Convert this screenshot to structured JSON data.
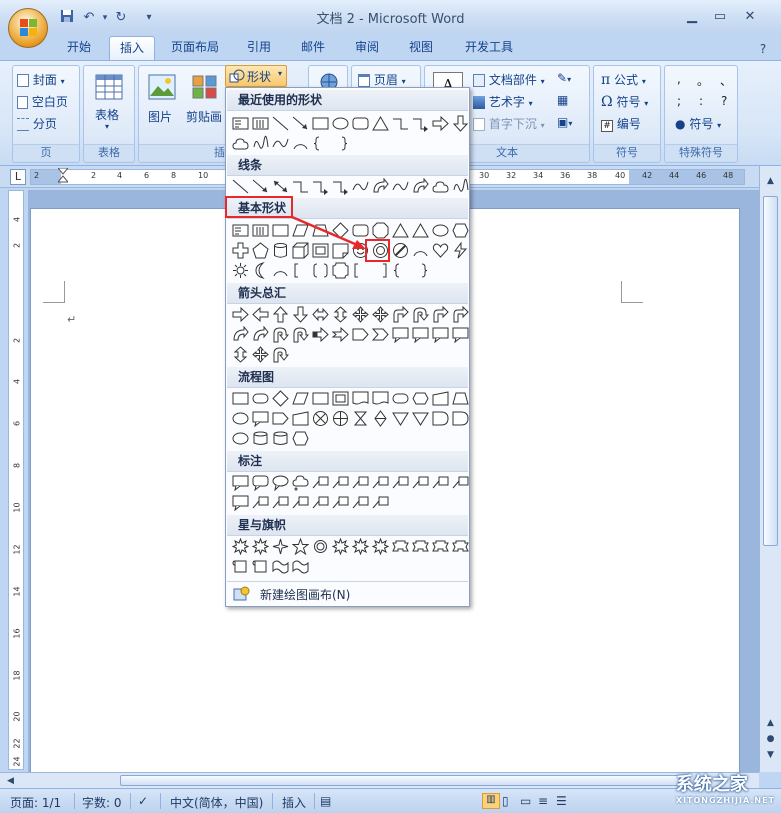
{
  "window": {
    "title": "文档 2 - Microsoft Word",
    "min_icon": "minimize-icon",
    "max_icon": "maximize-icon",
    "close_icon": "close-icon"
  },
  "tabs": [
    "开始",
    "插入",
    "页面布局",
    "引用",
    "邮件",
    "审阅",
    "视图",
    "开发工具"
  ],
  "active_tab": "插入",
  "ribbon": {
    "pages": {
      "items": [
        "封面",
        "空白页",
        "分页"
      ],
      "label": "页"
    },
    "table": {
      "item": "表格",
      "label": "表格"
    },
    "illustrations": {
      "picture": "图片",
      "clipart": "剪贴画",
      "shapes": "形状",
      "label": "插"
    },
    "header": {
      "item": "页眉"
    },
    "text": {
      "items": [
        "文档部件",
        "艺术字",
        "首字下沉"
      ],
      "label": "文本"
    },
    "symbols": {
      "items": [
        "公式",
        "符号",
        "编号"
      ],
      "label": "符号"
    },
    "special": {
      "chars": [
        ",",
        "。",
        "、",
        ";",
        ":",
        "?"
      ],
      "item": "符号",
      "label": "特殊符号"
    }
  },
  "ruler": {
    "ticks": [
      "2",
      "2",
      "4",
      "6",
      "8",
      "10",
      "30",
      "32",
      "34",
      "36",
      "38",
      "40",
      "42",
      "44",
      "46",
      "48"
    ],
    "vticks": [
      "4",
      "2",
      "2",
      "4",
      "6",
      "8",
      "10",
      "12",
      "14",
      "16",
      "18",
      "20",
      "22",
      "24"
    ]
  },
  "shapes_menu": {
    "categories": [
      "最近使用的形状",
      "线条",
      "基本形状",
      "箭头总汇",
      "流程图",
      "标注",
      "星与旗帜"
    ],
    "new_canvas": "新建绘图画布(N)",
    "highlighted_category": "基本形状",
    "highlighted_shape": "donut"
  },
  "status": {
    "page": "页面: 1/1",
    "words": "字数: 0",
    "language": "中文(简体，中国)",
    "mode": "插入"
  },
  "watermark": {
    "text": "系统之家",
    "sub": "XITONGZHIJIA.NET"
  },
  "colors": {
    "highlight": "#e8282a",
    "ribbon": "#d6e5f7",
    "accent": "#15428b"
  }
}
